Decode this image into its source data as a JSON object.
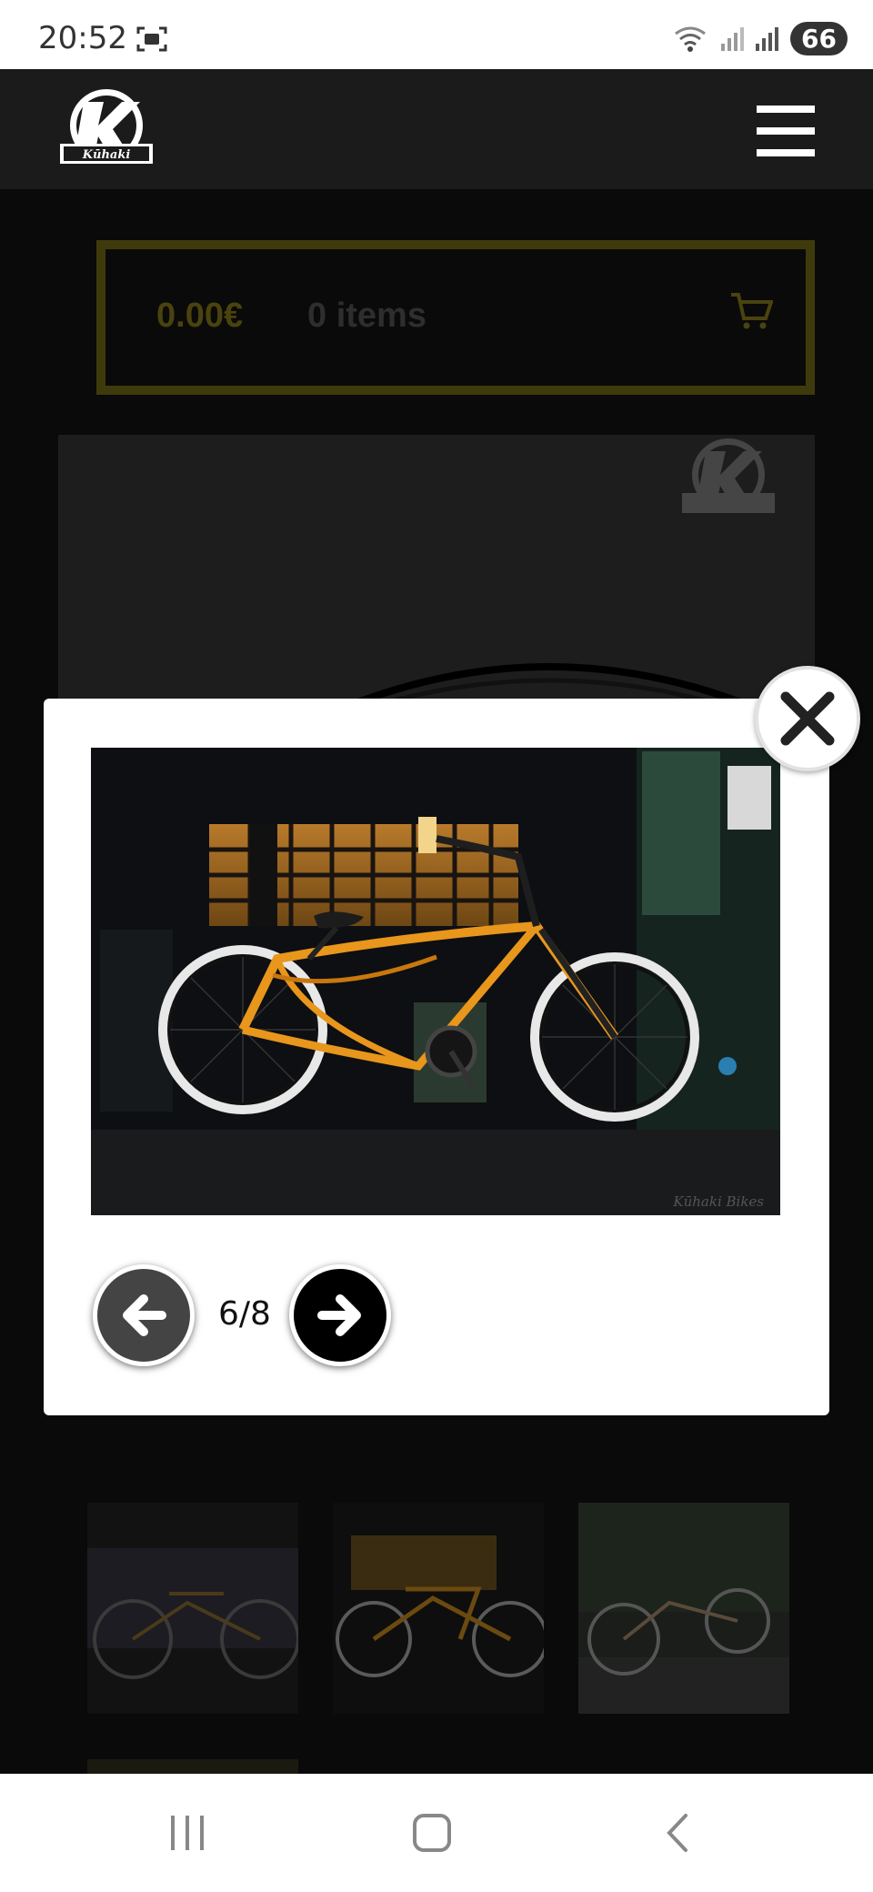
{
  "status_bar": {
    "time": "20:52",
    "battery": "66"
  },
  "header": {
    "logo_text": "Kūhaki"
  },
  "cart": {
    "total": "0.00€",
    "items": "0 items"
  },
  "lightbox": {
    "counter": "6/8",
    "watermark": "Kūhaki Bikes"
  },
  "colors": {
    "header_bg": "#1b1b1b",
    "accent_yellow": "#d4b800",
    "bike_orange": "#e8961c"
  },
  "icons": {
    "close": "close-icon",
    "prev": "arrow-left-icon",
    "next": "arrow-right-icon",
    "menu": "hamburger-menu-icon",
    "cart": "cart-icon",
    "android_recents": "recents-icon",
    "android_home": "home-icon",
    "android_back": "back-icon"
  }
}
